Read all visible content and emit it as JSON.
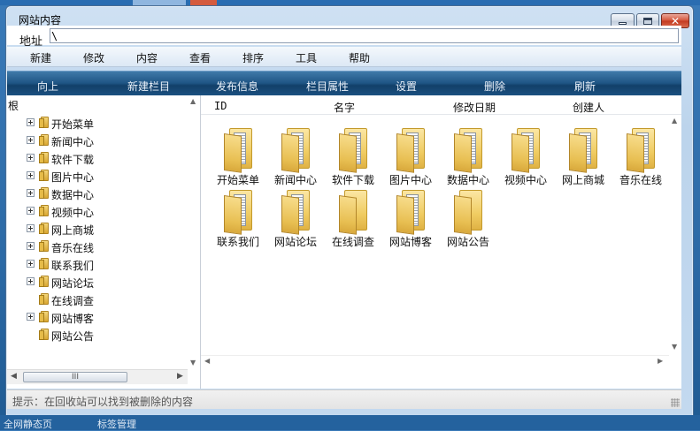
{
  "window": {
    "title": "网站内容"
  },
  "address": {
    "label": "地址",
    "value": "\\"
  },
  "menu": [
    "新建",
    "修改",
    "内容",
    "查看",
    "排序",
    "工具",
    "帮助"
  ],
  "toolbar": [
    "向上",
    "新建栏目",
    "发布信息",
    "栏目属性",
    "设置",
    "删除",
    "刷新"
  ],
  "tree": {
    "root": "根",
    "items": [
      {
        "label": "开始菜单",
        "expandable": true
      },
      {
        "label": "新闻中心",
        "expandable": true
      },
      {
        "label": "软件下载",
        "expandable": true
      },
      {
        "label": "图片中心",
        "expandable": true
      },
      {
        "label": "数据中心",
        "expandable": true
      },
      {
        "label": "视频中心",
        "expandable": true
      },
      {
        "label": "网上商城",
        "expandable": true
      },
      {
        "label": "音乐在线",
        "expandable": true
      },
      {
        "label": "联系我们",
        "expandable": true
      },
      {
        "label": "网站论坛",
        "expandable": true
      },
      {
        "label": "在线调查",
        "expandable": false
      },
      {
        "label": "网站博客",
        "expandable": true
      },
      {
        "label": "网站公告",
        "expandable": false
      }
    ]
  },
  "list": {
    "columns": [
      "ID",
      "名字",
      "修改日期",
      "创建人"
    ],
    "items": [
      {
        "label": "开始菜单",
        "has_content": true
      },
      {
        "label": "新闻中心",
        "has_content": true
      },
      {
        "label": "软件下载",
        "has_content": true
      },
      {
        "label": "图片中心",
        "has_content": true
      },
      {
        "label": "数据中心",
        "has_content": true
      },
      {
        "label": "视频中心",
        "has_content": true
      },
      {
        "label": "网上商城",
        "has_content": true
      },
      {
        "label": "音乐在线",
        "has_content": true
      },
      {
        "label": "联系我们",
        "has_content": true
      },
      {
        "label": "网站论坛",
        "has_content": true
      },
      {
        "label": "在线调查",
        "has_content": false
      },
      {
        "label": "网站博客",
        "has_content": true
      },
      {
        "label": "网站公告",
        "has_content": false
      }
    ]
  },
  "scrollbar": {
    "thumb_grip": "III"
  },
  "status": {
    "hint": "提示：在回收站可以找到被删除的内容"
  },
  "desktop": {
    "taskbar_left": "全网静态页",
    "taskbar_mid": "标签管理"
  },
  "colors": {
    "toolbar_dark": "#123f69",
    "toolbar_light": "#3f79a8",
    "folder_yellow": "#f0cc62",
    "close_red": "#d4563c"
  }
}
